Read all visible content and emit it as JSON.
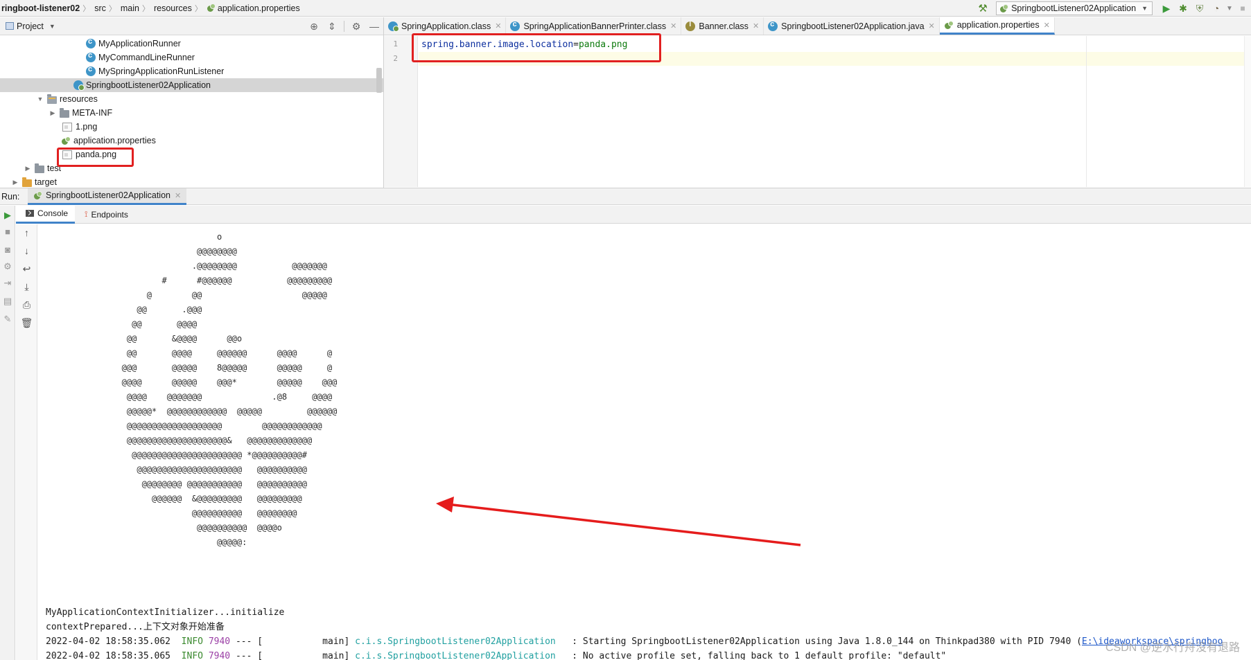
{
  "navbar": {
    "crumbs": [
      "ringboot-listener02",
      "src",
      "main",
      "resources",
      "application.properties"
    ],
    "run_config": "SpringbootListener02Application"
  },
  "project": {
    "title": "Project",
    "tree": [
      {
        "label": "MyApplicationRunner",
        "icon": "class-icon"
      },
      {
        "label": "MyCommandLineRunner",
        "icon": "class-icon"
      },
      {
        "label": "MySpringApplicationRunListener",
        "icon": "class-icon"
      },
      {
        "label": "SpringbootListener02Application",
        "icon": "spring-boot-class-icon"
      },
      {
        "label": "resources",
        "icon": "resources-folder-icon"
      },
      {
        "label": "META-INF",
        "icon": "folder-icon"
      },
      {
        "label": "1.png",
        "icon": "image-file-icon"
      },
      {
        "label": "application.properties",
        "icon": "properties-file-icon"
      },
      {
        "label": "panda.png",
        "icon": "image-file-icon"
      },
      {
        "label": "test",
        "icon": "folder-icon"
      },
      {
        "label": "target",
        "icon": "folder-icon"
      }
    ]
  },
  "editor": {
    "tabs": [
      {
        "label": "SpringApplication.class",
        "active": false
      },
      {
        "label": "SpringApplicationBannerPrinter.class",
        "active": false
      },
      {
        "label": "Banner.class",
        "active": false
      },
      {
        "label": "SpringbootListener02Application.java",
        "active": false
      },
      {
        "label": "application.properties",
        "active": true
      }
    ],
    "line_numbers": [
      "1",
      "2"
    ],
    "code_key": "spring.banner.image.location",
    "code_eq": "=",
    "code_value": "panda.png"
  },
  "run": {
    "label": "Run:",
    "tab": "SpringbootListener02Application",
    "subtabs": [
      "Console",
      "Endpoints"
    ],
    "banner_art": [
      "                      o",
      "                  @@@@@@@@",
      "                 .@@@@@@@@           @@@@@@@",
      "           #      #@@@@@@           @@@@@@@@@",
      "        @        @@                    @@@@@",
      "      @@       .@@@",
      "     @@       @@@@",
      "    @@       &@@@@      @@o",
      "    @@       @@@@     @@@@@@      @@@@      @",
      "   @@@       @@@@@    8@@@@@      @@@@@     @",
      "   @@@@      @@@@@    @@@*        @@@@@    @@@",
      "    @@@@    @@@@@@@              .@8     @@@@",
      "    @@@@@*  @@@@@@@@@@@@  @@@@@         @@@@@@",
      "    @@@@@@@@@@@@@@@@@@@        @@@@@@@@@@@@",
      "    @@@@@@@@@@@@@@@@@@@@&   @@@@@@@@@@@@@",
      "     @@@@@@@@@@@@@@@@@@@@@@ *@@@@@@@@@@#",
      "      @@@@@@@@@@@@@@@@@@@@@   @@@@@@@@@@",
      "       @@@@@@@@ @@@@@@@@@@@   @@@@@@@@@@",
      "         @@@@@@  &@@@@@@@@@   @@@@@@@@@",
      "                 @@@@@@@@@@   @@@@@@@@",
      "                  @@@@@@@@@@  @@@@o",
      "                      @@@@@:"
    ],
    "logs": [
      {
        "text": "MyApplicationContextInitializer...initialize"
      },
      {
        "text": "contextPrepared...上下文对象开始准备"
      },
      {
        "date": "2022-04-02 18:58:35.062",
        "level": "INFO",
        "pid": "7940",
        "thread": " --- [           main]",
        "logger": "c.i.s.SpringbootListener02Application",
        "message": "   : Starting SpringbootListener02Application using Java 1.8.0_144 on Thinkpad380 with PID 7940 (",
        "path": "E:\\ideaworkspace\\springboo"
      },
      {
        "date": "2022-04-02 18:58:35.065",
        "level": "INFO",
        "pid": "7940",
        "thread": " --- [           main]",
        "logger": "c.i.s.SpringbootListener02Application",
        "message": "   : No active profile set, falling back to 1 default profile: \"default\"",
        "path": ""
      }
    ]
  },
  "watermark": "CSDN @逆水行舟没有退路"
}
